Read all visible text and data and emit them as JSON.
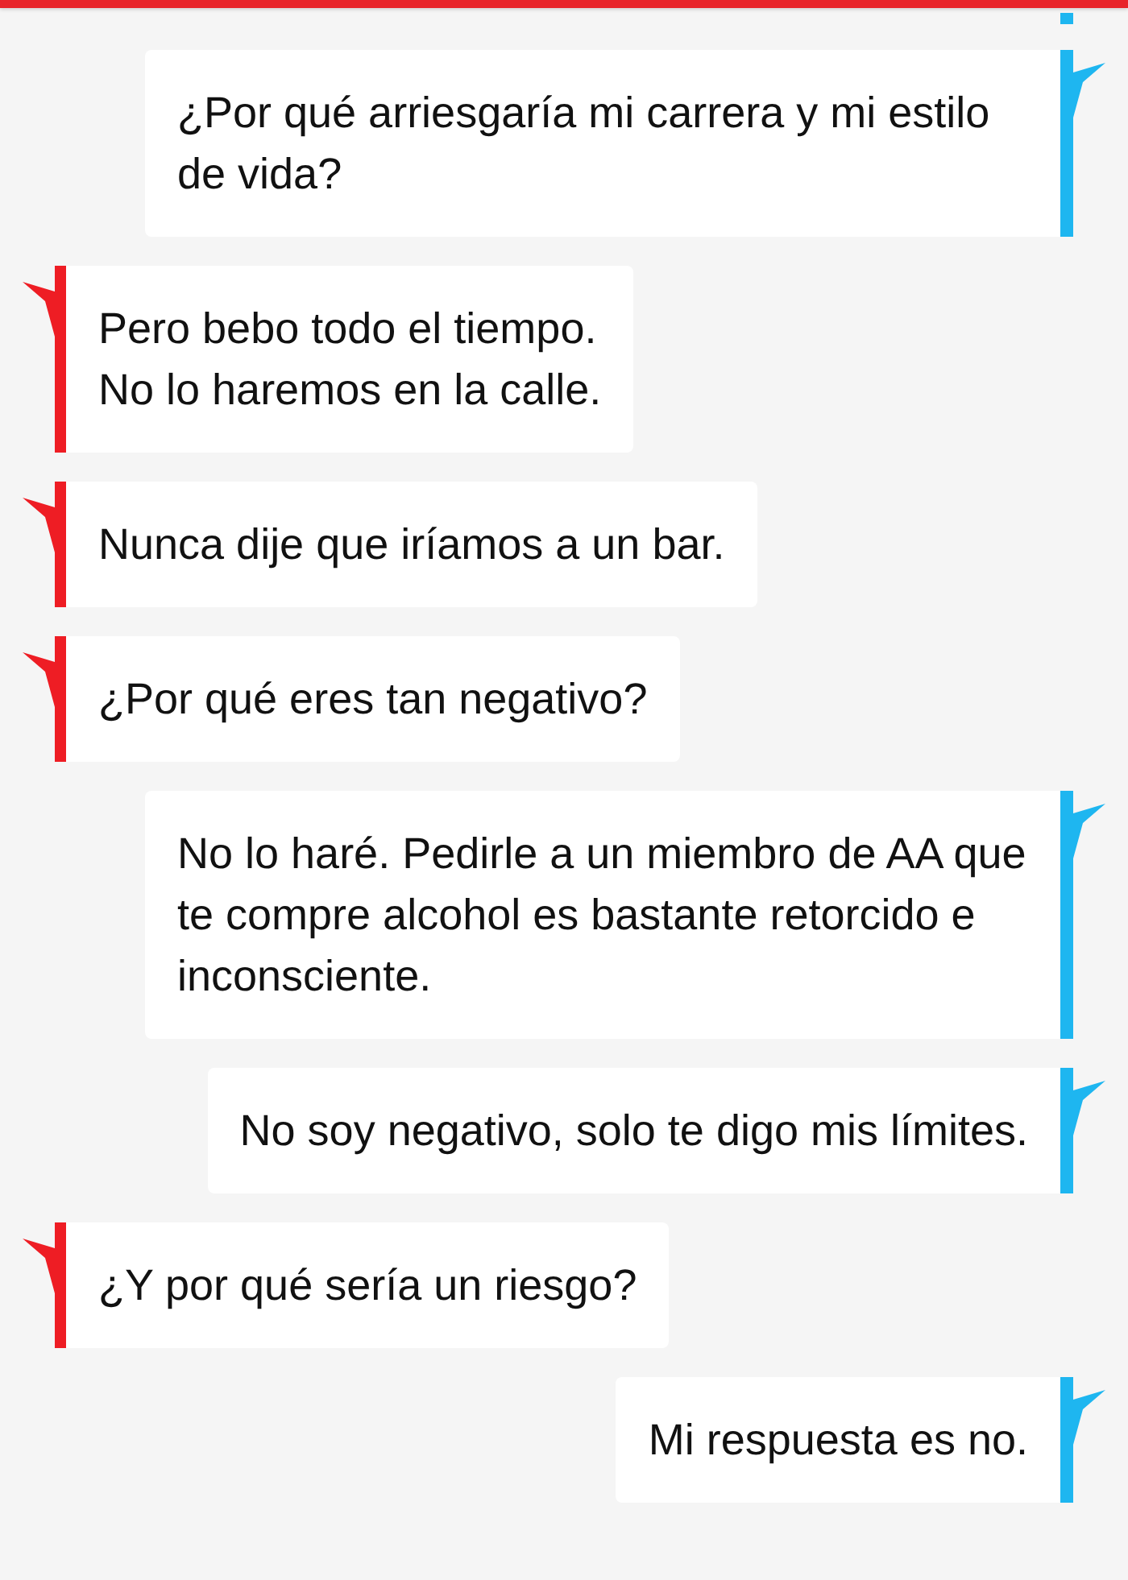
{
  "messages": [
    {
      "kind": "sent",
      "text": "¿Por qué arriesgaría mi carrera y mi estilo de vida?"
    },
    {
      "kind": "received",
      "text": "Pero bebo todo el tiempo.\nNo lo haremos en la calle."
    },
    {
      "kind": "received",
      "text": "Nunca dije que iríamos a un bar."
    },
    {
      "kind": "received",
      "text": "¿Por qué eres tan negativo?"
    },
    {
      "kind": "sent",
      "text": "No lo haré. Pedirle a un miembro de AA que te compre alcohol es bastante retorcido e inconsciente."
    },
    {
      "kind": "sent",
      "text": "No soy negativo, solo te digo mis límites."
    },
    {
      "kind": "received",
      "text": "¿Y por qué sería un riesgo?"
    },
    {
      "kind": "sent",
      "text": "Mi respuesta es no."
    }
  ]
}
